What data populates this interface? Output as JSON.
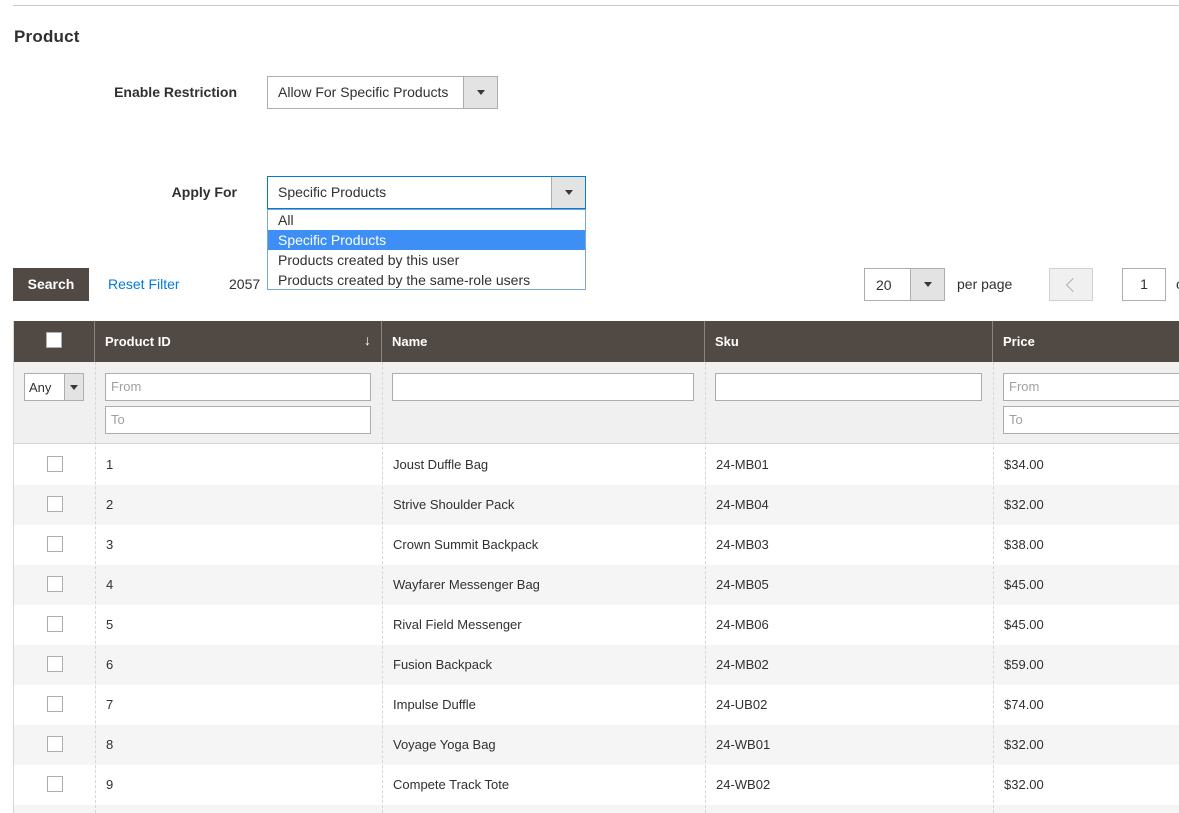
{
  "section": {
    "title": "Product"
  },
  "restriction": {
    "label": "Enable Restriction",
    "value": "Allow For Specific Products"
  },
  "apply_for": {
    "label": "Apply For",
    "value": "Specific Products",
    "options": [
      "All",
      "Specific Products",
      "Products created by this user",
      "Products created by the same-role users"
    ],
    "selected_index": 1
  },
  "toolbar": {
    "search_label": "Search",
    "reset_label": "Reset Filter",
    "records": "2057",
    "per_page_value": "20",
    "per_page_label": "per page",
    "page": "1",
    "page_of": "of"
  },
  "grid": {
    "columns": [
      "Product ID",
      "Name",
      "Sku",
      "Price"
    ],
    "sort_indicator": "↓",
    "filters": {
      "any_value": "Any",
      "from_placeholder": "From",
      "to_placeholder": "To"
    },
    "rows": [
      {
        "id": "1",
        "name": "Joust Duffle Bag",
        "sku": "24-MB01",
        "price": "$34.00"
      },
      {
        "id": "2",
        "name": "Strive Shoulder Pack",
        "sku": "24-MB04",
        "price": "$32.00"
      },
      {
        "id": "3",
        "name": "Crown Summit Backpack",
        "sku": "24-MB03",
        "price": "$38.00"
      },
      {
        "id": "4",
        "name": "Wayfarer Messenger Bag",
        "sku": "24-MB05",
        "price": "$45.00"
      },
      {
        "id": "5",
        "name": "Rival Field Messenger",
        "sku": "24-MB06",
        "price": "$45.00"
      },
      {
        "id": "6",
        "name": "Fusion Backpack",
        "sku": "24-MB02",
        "price": "$59.00"
      },
      {
        "id": "7",
        "name": "Impulse Duffle",
        "sku": "24-UB02",
        "price": "$74.00"
      },
      {
        "id": "8",
        "name": "Voyage Yoga Bag",
        "sku": "24-WB01",
        "price": "$32.00"
      },
      {
        "id": "9",
        "name": "Compete Track Tote",
        "sku": "24-WB02",
        "price": "$32.00"
      }
    ]
  }
}
